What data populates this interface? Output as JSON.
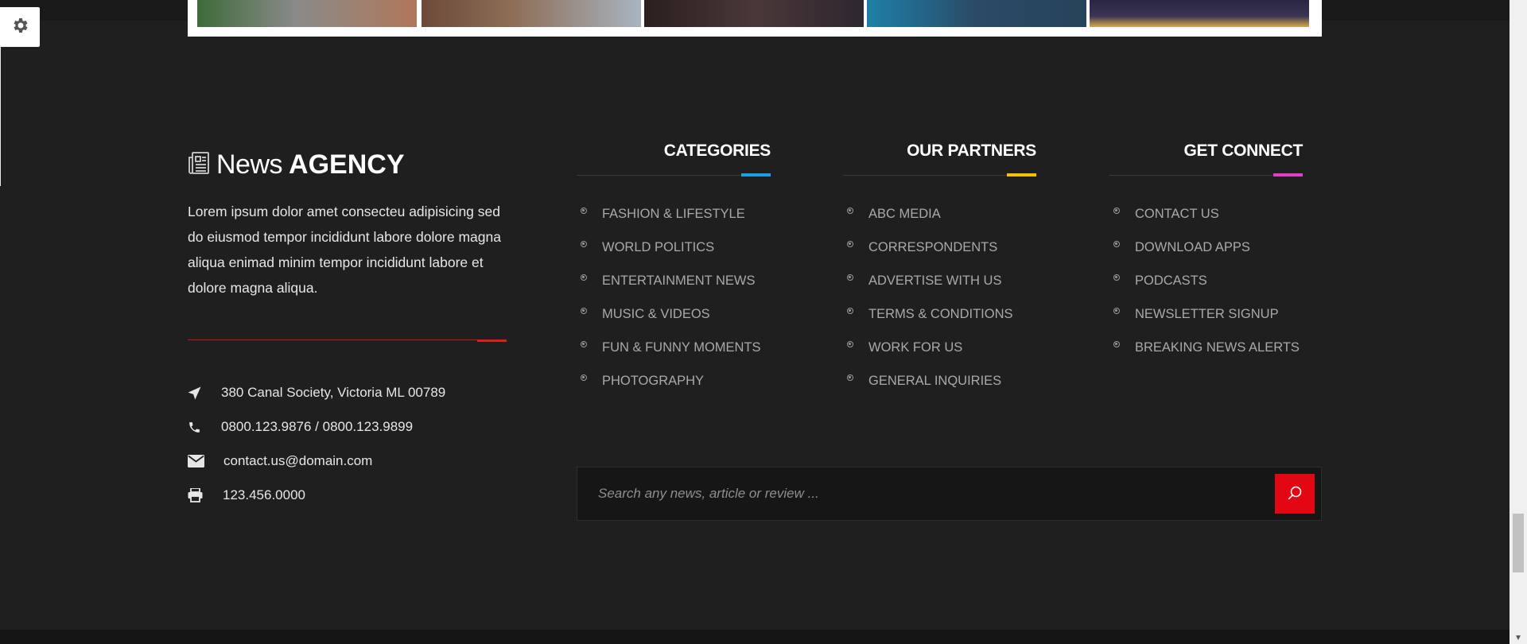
{
  "brand": {
    "word1": "News",
    "word2": "AGENCY"
  },
  "about": {
    "text": "Lorem ipsum dolor amet consecteu adipisicing sed do eiusmod tempor incididunt labore dolore magna aliqua enimad minim tempor incididunt labore et dolore magna aliqua."
  },
  "contact": {
    "address": "380 Canal Society, Victoria ML 00789",
    "phone": "0800.123.9876 / 0800.123.9899",
    "email": "contact.us@domain.com",
    "fax": "123.456.0000"
  },
  "categories": {
    "title": "CATEGORIES",
    "accent": "#1ba1e2",
    "items": [
      "FASHION & LIFESTYLE",
      "WORLD POLITICS",
      "ENTERTAINMENT NEWS",
      "MUSIC & VIDEOS",
      "FUN & FUNNY MOMENTS",
      "PHOTOGRAPHY"
    ]
  },
  "partners": {
    "title": "OUR PARTNERS",
    "accent": "#f2c200",
    "items": [
      "ABC MEDIA",
      "CORRESPONDENTS",
      "ADVERTISE WITH US",
      "TERMS & CONDITIONS",
      "WORK FOR US",
      "GENERAL INQUIRIES"
    ]
  },
  "connect": {
    "title": "GET CONNECT",
    "accent": "#e040c8",
    "items": [
      "CONTACT US",
      "DOWNLOAD APPS",
      "PODCASTS",
      "NEWSLETTER SIGNUP",
      "BREAKING NEWS ALERTS"
    ]
  },
  "search": {
    "placeholder": "Search any news, article or review ..."
  },
  "colors": {
    "accent_red": "#e30613",
    "background": "#1f1f1f"
  },
  "icons": {
    "settings": "gear-icon",
    "address": "location-arrow-icon",
    "phone": "phone-icon",
    "email": "envelope-icon",
    "fax": "printer-icon",
    "search": "search-icon",
    "logo": "newspaper-icon"
  }
}
